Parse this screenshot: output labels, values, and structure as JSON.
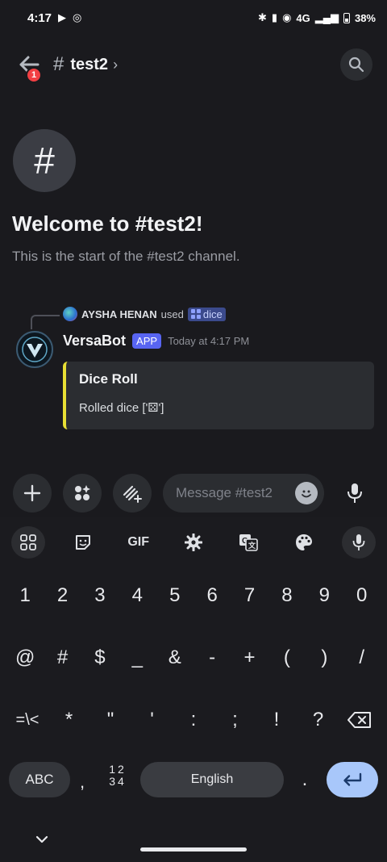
{
  "status_bar": {
    "time": "4:17",
    "network": "4G",
    "battery": "38%"
  },
  "header": {
    "channel_name": "test2",
    "notification_count": "1",
    "back_icon": "arrow-left-icon",
    "search_icon": "search-icon"
  },
  "welcome": {
    "title": "Welcome to #test2!",
    "subtitle": "This is the start of the #test2 channel."
  },
  "message": {
    "interaction_user": "AYSHA HENAN",
    "interaction_verb": "used",
    "command": "dice",
    "author": "VersaBot",
    "author_tag": "APP",
    "timestamp": "Today at 4:17 PM",
    "embed": {
      "title": "Dice Roll",
      "description": "Rolled dice ['⚄']",
      "accent_color": "#e8df34"
    }
  },
  "composer": {
    "placeholder": "Message #test2",
    "add_icon": "plus-icon",
    "apps_icon": "apps-icon",
    "gift_icon": "activity-icon",
    "emoji_icon": "emoji-icon",
    "mic_icon": "mic-icon"
  },
  "keyboard": {
    "toolbar": {
      "gif_label": "GIF"
    },
    "row1": [
      "1",
      "2",
      "3",
      "4",
      "5",
      "6",
      "7",
      "8",
      "9",
      "0"
    ],
    "row2": [
      "@",
      "#",
      "$",
      "_",
      "&",
      "-",
      "+",
      "(",
      ")",
      "/"
    ],
    "row3": [
      "=\\<",
      "*",
      "\"",
      "'",
      ":",
      ";",
      "!",
      "?"
    ],
    "abc_label": "ABC",
    "comma_label": ",",
    "numpad_top": "12",
    "numpad_bottom": "34",
    "space_label": "English",
    "period_label": ".",
    "accent": "#a8c7fa"
  }
}
